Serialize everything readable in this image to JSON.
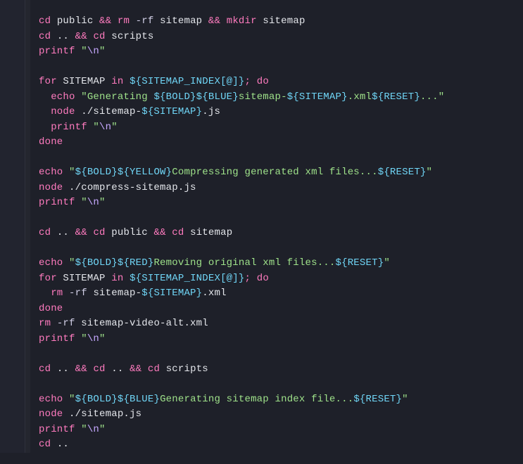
{
  "tokens": {
    "cd": "cd",
    "public": "public",
    "amp": "&&",
    "rm": "rm",
    "rf_arg": "-rf",
    "sitemap": "sitemap",
    "mkdir": "mkdir",
    "dotdot": "..",
    "scripts": "scripts",
    "printf": "printf",
    "nl_esc": "\\n",
    "for": "for",
    "SITEMAP": "SITEMAP",
    "in": "in",
    "idx_expr": "${SITEMAP_INDEX[@]}",
    "semi": ";",
    "do": "do",
    "echo": "echo",
    "gen_pre": "Generating ",
    "bold": "${BOLD}",
    "blue": "${BLUE}",
    "sitemap_dash": "sitemap-",
    "sitemap_var": "${SITEMAP}",
    "xml": ".xml",
    "reset": "${RESET}",
    "ellipsis": "...",
    "node": "node",
    "node_sitemap_pre": "./sitemap-",
    "js": ".js",
    "done": "done",
    "yellow": "${YELLOW}",
    "compress_msg": "Compressing generated xml files...",
    "compress_js": "./compress-sitemap.js",
    "red": "${RED}",
    "remove_msg": "Removing original xml files...",
    "sitemap_video": "sitemap-video-alt.xml",
    "gen_idx_msg": "Generating sitemap index file...",
    "sitemap_js": "./sitemap.js"
  }
}
